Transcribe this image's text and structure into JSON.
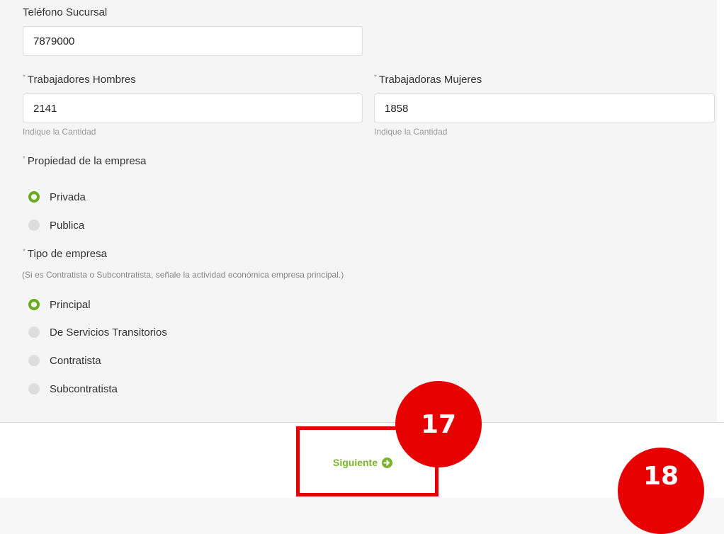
{
  "fields": {
    "telefono": {
      "label": "Teléfono Sucursal",
      "value": "7879000"
    },
    "hombres": {
      "label": "Trabajadores Hombres",
      "value": "2141",
      "help": "Indique la Cantidad"
    },
    "mujeres": {
      "label": "Trabajadoras Mujeres",
      "value": "1858",
      "help": "Indique la Cantidad"
    }
  },
  "required_mark": "*",
  "propiedad": {
    "label": "Propiedad de la empresa",
    "options": [
      "Privada",
      "Publica"
    ],
    "selected": "Privada"
  },
  "tipo": {
    "label": "Tipo de empresa",
    "note": "(Si es Contratista o Subcontratista, señale la actividad económica empresa principal.)",
    "options": [
      "Principal",
      "De Servicios Transitorios",
      "Contratista",
      "Subcontratista"
    ],
    "selected": "Principal"
  },
  "footer": {
    "next_label": "Siguiente"
  },
  "annotations": {
    "badge_17": "17",
    "badge_18": "18"
  },
  "colors": {
    "accent": "#7ab32e",
    "annotation": "#e60000"
  },
  "icons": {
    "next": "arrow-circle-right-icon"
  }
}
